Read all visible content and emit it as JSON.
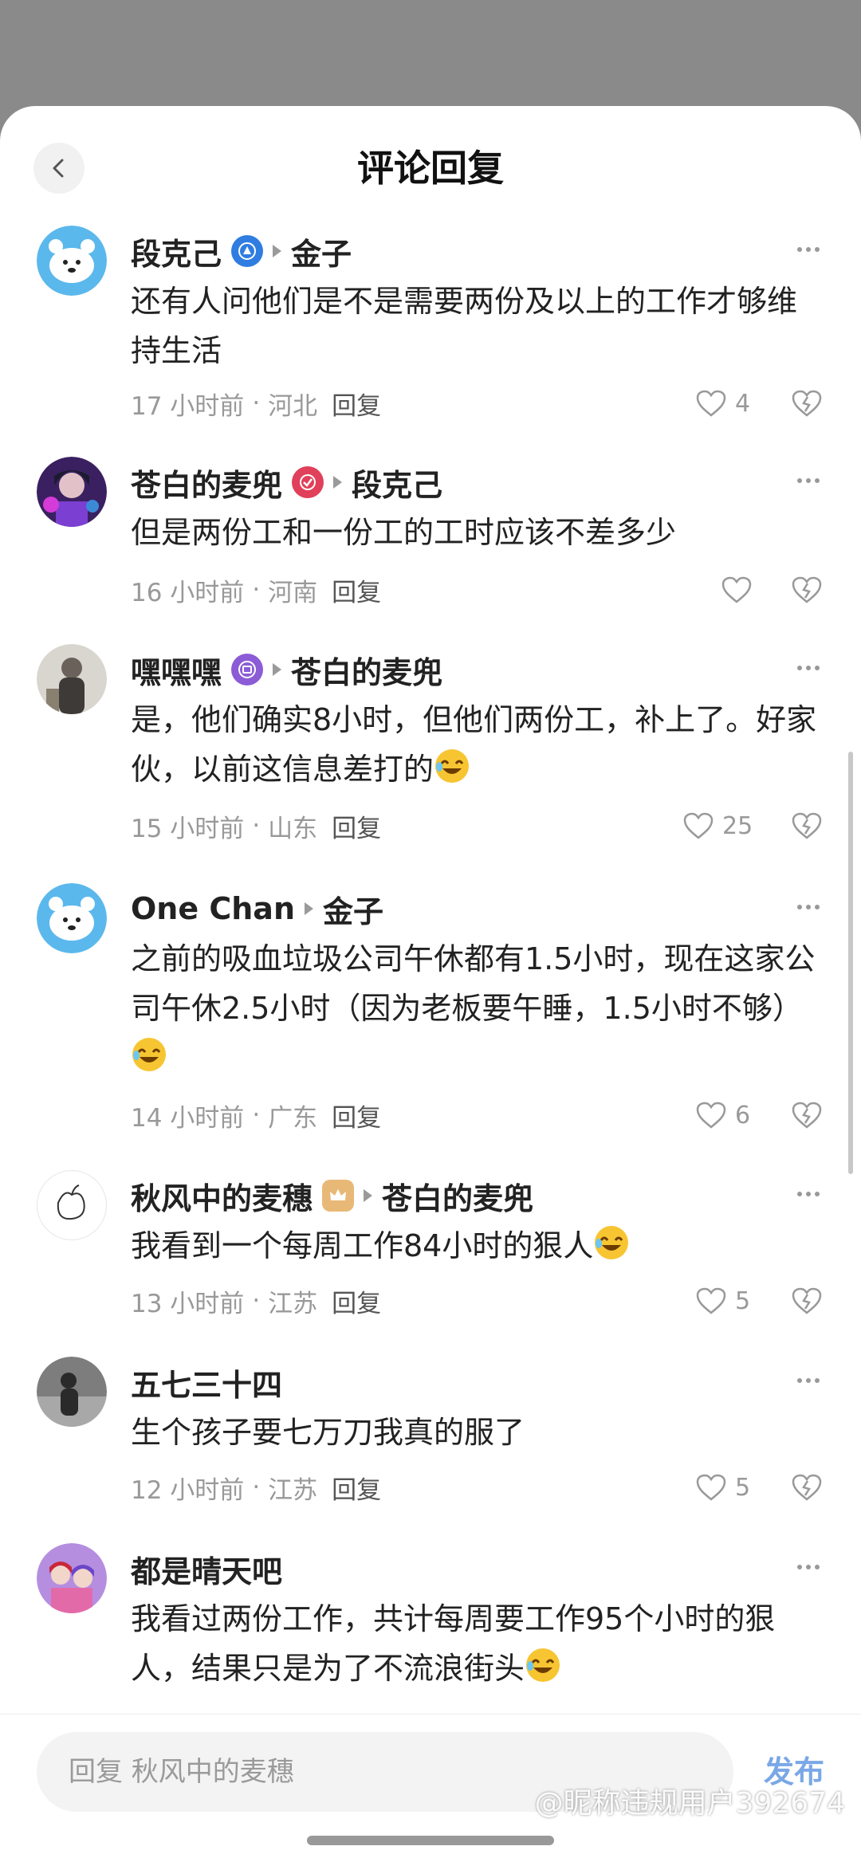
{
  "header": {
    "title": "评论回复"
  },
  "comments": [
    {
      "author": "段克己",
      "reply_to": "金子",
      "text": "还有人问他们是不是需要两份及以上的工作才够维持生活",
      "time": "17 小时前",
      "region": "河北",
      "reply_label": "回复",
      "likes": "4",
      "badge": "blue-triangle-badge-icon"
    },
    {
      "author": "苍白的麦兜",
      "reply_to": "段克己",
      "text": "但是两份工和一份工的工时应该不差多少",
      "time": "16 小时前",
      "region": "河南",
      "reply_label": "回复",
      "likes": "",
      "badge": "red-check-badge-icon"
    },
    {
      "author": "嘿嘿嘿",
      "reply_to": "苍白的麦兜",
      "text": "是，他们确实8小时，但他们两份工，补上了。好家伙，以前这信息差打的",
      "time": "15 小时前",
      "region": "山东",
      "reply_label": "回复",
      "likes": "25",
      "badge": "purple-screen-badge-icon"
    },
    {
      "author": "One Chan",
      "reply_to": "金子",
      "text": "之前的吸血垃圾公司午休都有1.5小时，现在这家公司午休2.5小时（因为老板要午睡，1.5小时不够）",
      "time": "14 小时前",
      "region": "广东",
      "reply_label": "回复",
      "likes": "6"
    },
    {
      "author": "秋风中的麦穗",
      "reply_to": "苍白的麦兜",
      "text": "我看到一个每周工作84小时的狠人",
      "time": "13 小时前",
      "region": "江苏",
      "reply_label": "回复",
      "likes": "5",
      "badge": "gold-crown-badge-icon"
    },
    {
      "author": "五七三十四",
      "text": "生个孩子要七万刀我真的服了",
      "time": "12 小时前",
      "region": "江苏",
      "reply_label": "回复",
      "likes": "5"
    },
    {
      "author": "都是晴天吧",
      "text": "我看过两份工作，共计每周要工作95个小时的狠人，结果只是为了不流浪街头"
    }
  ],
  "reply_box": {
    "placeholder": "回复 秋风中的麦穗",
    "publish_label": "发布"
  },
  "watermark": "@昵称违规用户392674",
  "colors": {
    "accent": "#7aa7e6",
    "meta": "#999999",
    "text": "#222222"
  }
}
